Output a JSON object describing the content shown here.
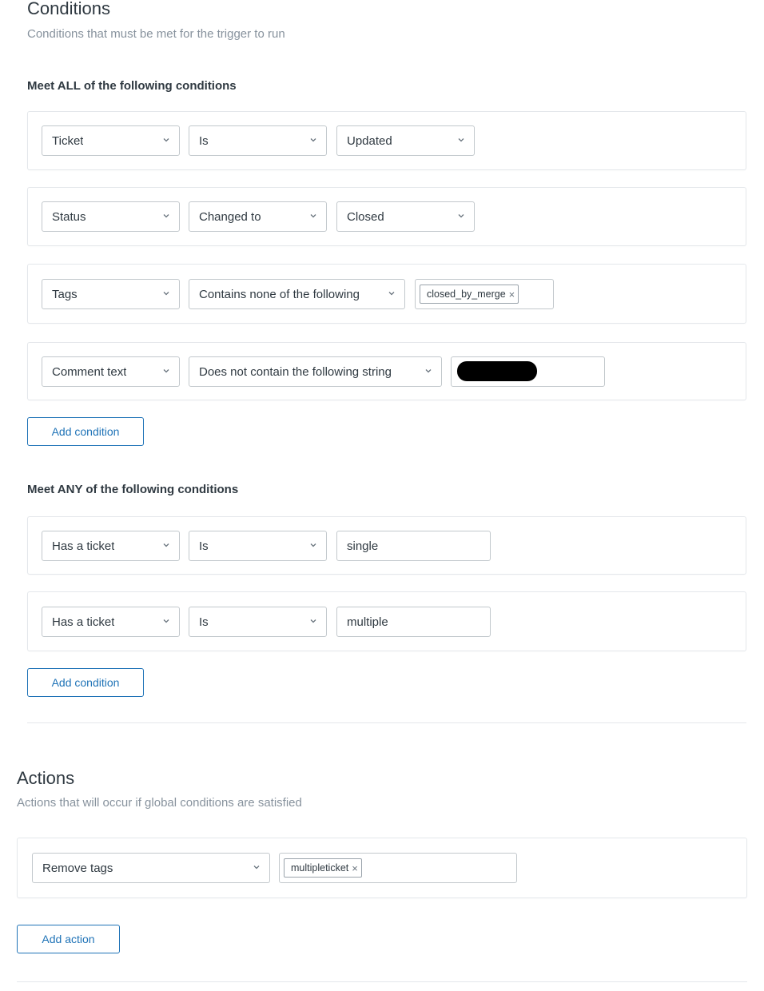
{
  "conditions": {
    "title": "Conditions",
    "description": "Conditions that must be met for the trigger to run",
    "all": {
      "heading": "Meet ALL of the following conditions",
      "rows": [
        {
          "field": "Ticket",
          "operator": "Is",
          "value": "Updated"
        },
        {
          "field": "Status",
          "operator": "Changed to",
          "value": "Closed"
        },
        {
          "field": "Tags",
          "operator": "Contains none of the following",
          "tag": "closed_by_merge"
        },
        {
          "field": "Comment text",
          "operator": "Does not contain the following string",
          "value": ""
        }
      ],
      "add_button": "Add condition"
    },
    "any": {
      "heading": "Meet ANY of the following conditions",
      "rows": [
        {
          "field": "Has a ticket",
          "operator": "Is",
          "value": "single"
        },
        {
          "field": "Has a ticket",
          "operator": "Is",
          "value": "multiple"
        }
      ],
      "add_button": "Add condition"
    }
  },
  "actions": {
    "title": "Actions",
    "description": "Actions that will occur if global conditions are satisfied",
    "rows": [
      {
        "action": "Remove tags",
        "tag": "multipleticket"
      }
    ],
    "add_button": "Add action"
  },
  "icons": {
    "dropdown": "chevron-down-icon",
    "remove": "close-icon"
  },
  "colors": {
    "accent": "#1f73b7",
    "border": "#c2c8cc",
    "muted": "#87929d",
    "text": "#2f3941"
  }
}
